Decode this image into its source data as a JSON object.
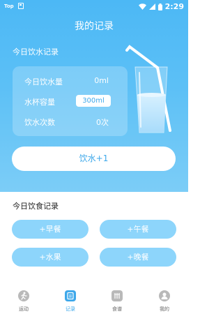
{
  "status_bar": {
    "app_badge": "Top",
    "time": "2:29"
  },
  "page_title": "我的记录",
  "water": {
    "section_title": "今日饮水记录",
    "stats": [
      {
        "label": "今日饮水量",
        "value": "0ml"
      },
      {
        "label": "水杯容量",
        "value": "300ml"
      },
      {
        "label": "饮水次数",
        "value": "0次"
      }
    ],
    "drink_button_label": "饮水+1"
  },
  "food": {
    "section_title": "今日饮食记录",
    "meals": [
      {
        "label": "+早餐"
      },
      {
        "label": "+午餐"
      },
      {
        "label": "+水果"
      },
      {
        "label": "+晚餐"
      }
    ]
  },
  "bottom_nav": {
    "items": [
      {
        "label": "运动",
        "icon": "running-icon"
      },
      {
        "label": "记录",
        "icon": "record-icon",
        "active": true
      },
      {
        "label": "食谱",
        "icon": "recipe-icon"
      },
      {
        "label": "我的",
        "icon": "profile-icon"
      }
    ]
  },
  "colors": {
    "hero_top": "#4cb8f5",
    "hero_bottom": "#7ccdf7",
    "accent": "#3ea8ea",
    "meal_button": "#8dd5fb"
  }
}
